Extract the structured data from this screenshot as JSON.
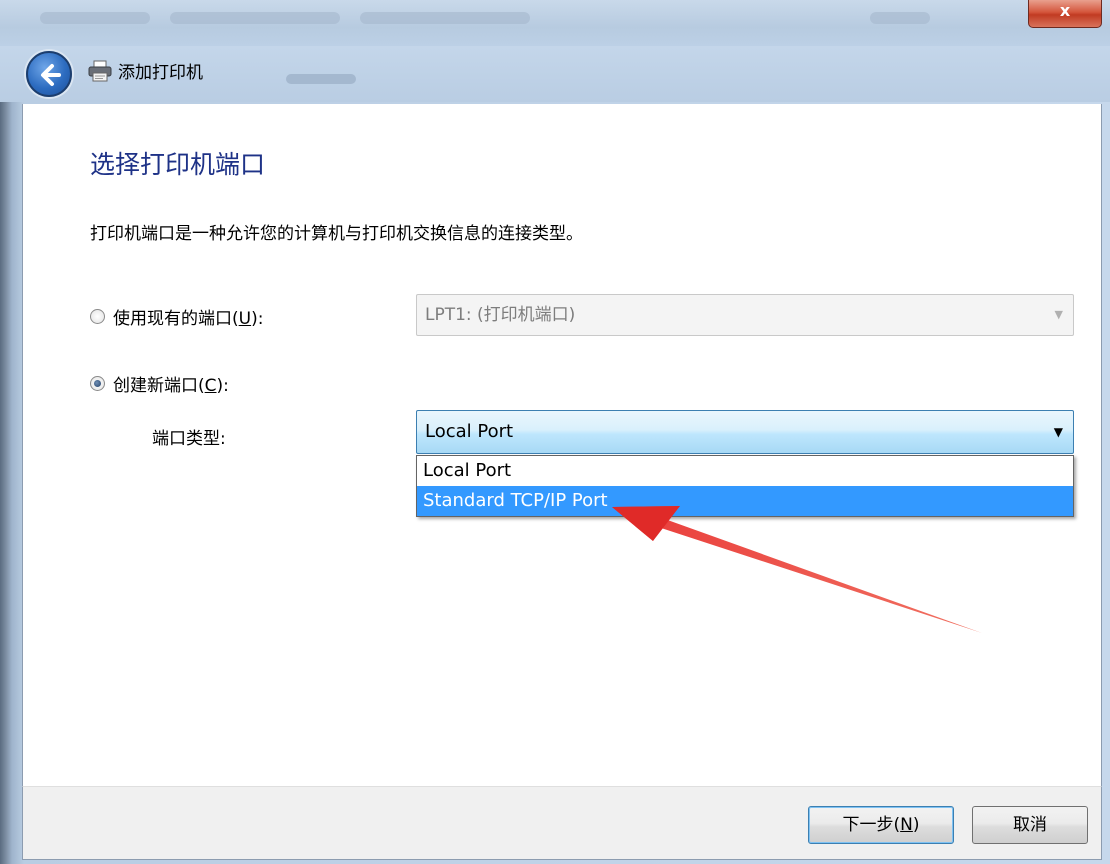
{
  "window": {
    "title": "添加打印机",
    "close_label": "x"
  },
  "page": {
    "heading": "选择打印机端口",
    "description": "打印机端口是一种允许您的计算机与打印机交换信息的连接类型。"
  },
  "existing_port": {
    "label_prefix": "使用现有的端口(",
    "label_accel": "U",
    "label_suffix": "):",
    "selected": false,
    "value": "LPT1: (打印机端口)"
  },
  "new_port": {
    "label_prefix": "创建新端口(",
    "label_accel": "C",
    "label_suffix": "):",
    "selected": true,
    "type_label": "端口类型:",
    "value": "Local Port",
    "options": [
      "Local Port",
      "Standard TCP/IP Port"
    ],
    "highlighted_option": "Standard TCP/IP Port"
  },
  "footer": {
    "next_prefix": "下一步(",
    "next_accel": "N",
    "next_suffix": ")",
    "cancel_label": "取消"
  },
  "colors": {
    "heading": "#1e3287",
    "highlight": "#3399ff",
    "annotation_arrow": "#e8312f"
  }
}
